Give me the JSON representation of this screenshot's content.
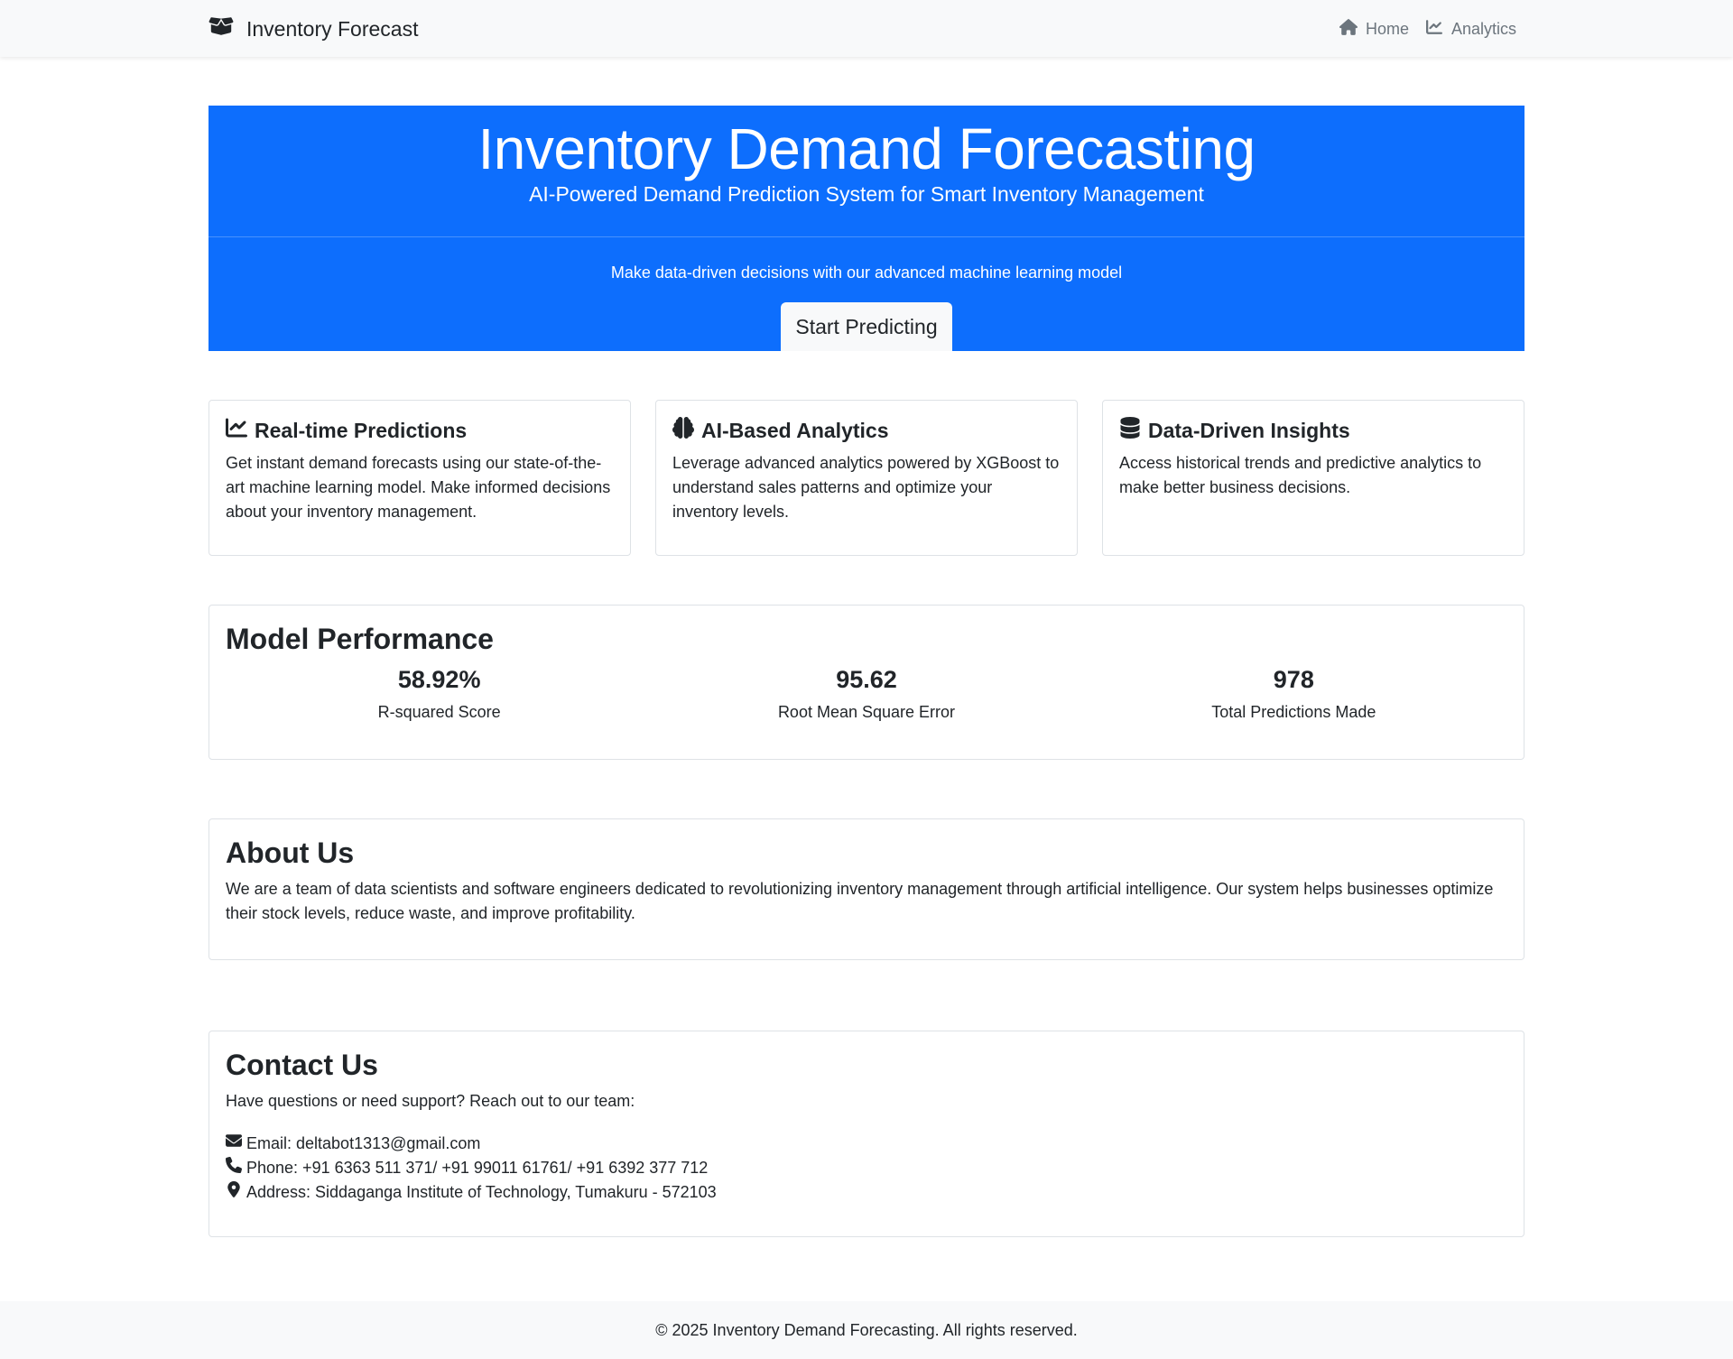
{
  "navbar": {
    "brand": "Inventory Forecast",
    "brand_icon": "box-open-icon",
    "links": [
      {
        "label": "Home",
        "icon": "home-icon"
      },
      {
        "label": "Analytics",
        "icon": "chart-line-icon"
      }
    ]
  },
  "hero": {
    "title": "Inventory Demand Forecasting",
    "subtitle": "AI-Powered Demand Prediction System for Smart Inventory Management",
    "lead": "Make data-driven decisions with our advanced machine learning model",
    "button_label": "Start Predicting",
    "background_color": "#0d6efd"
  },
  "features": [
    {
      "icon": "chart-line-icon",
      "title": "Real-time Predictions",
      "text": "Get instant demand forecasts using our state-of-the-art machine learning model. Make informed decisions about your inventory management."
    },
    {
      "icon": "brain-icon",
      "title": "AI-Based Analytics",
      "text": "Leverage advanced analytics powered by XGBoost to understand sales patterns and optimize your inventory levels."
    },
    {
      "icon": "database-icon",
      "title": "Data-Driven Insights",
      "text": "Access historical trends and predictive analytics to make better business decisions."
    }
  ],
  "performance": {
    "title": "Model Performance",
    "metrics": [
      {
        "value": "58.92%",
        "label": "R-squared Score"
      },
      {
        "value": "95.62",
        "label": "Root Mean Square Error"
      },
      {
        "value": "978",
        "label": "Total Predictions Made"
      }
    ]
  },
  "about": {
    "title": "About Us",
    "text": "We are a team of data scientists and software engineers dedicated to revolutionizing inventory management through artificial intelligence. Our system helps businesses optimize their stock levels, reduce waste, and improve profitability."
  },
  "contact": {
    "title": "Contact Us",
    "intro": "Have questions or need support? Reach out to our team:",
    "items": [
      {
        "icon": "envelope-icon",
        "text": "Email: deltabot1313@gmail.com"
      },
      {
        "icon": "phone-icon",
        "text": "Phone: +91 6363 511 371/ +91 99011 61761/ +91 6392 377 712"
      },
      {
        "icon": "map-marker-icon",
        "text": "Address: Siddaganga Institute of Technology, Tumakuru - 572103"
      }
    ]
  },
  "footer": {
    "text": "© 2025 Inventory Demand Forecasting. All rights reserved."
  }
}
